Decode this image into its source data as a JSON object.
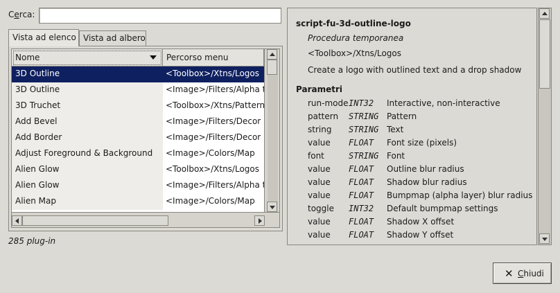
{
  "search": {
    "label_pre": "C",
    "label_underline": "e",
    "label_post": "rca:",
    "value": ""
  },
  "tabs": [
    {
      "label": "Vista ad elenco",
      "active": true
    },
    {
      "label": "Vista ad albero",
      "active": false
    }
  ],
  "list": {
    "columns": [
      "Nome",
      "Percorso menu"
    ],
    "rows": [
      {
        "name": "3D Outline",
        "path": "<Toolbox>/Xtns/Logos",
        "selected": true
      },
      {
        "name": "3D Outline",
        "path": "<Image>/Filters/Alpha to Logo"
      },
      {
        "name": "3D Truchet",
        "path": "<Toolbox>/Xtns/Patterns"
      },
      {
        "name": "Add Bevel",
        "path": "<Image>/Filters/Decor"
      },
      {
        "name": "Add Border",
        "path": "<Image>/Filters/Decor"
      },
      {
        "name": "Adjust Foreground & Background",
        "path": "<Image>/Colors/Map"
      },
      {
        "name": "Alien Glow",
        "path": "<Toolbox>/Xtns/Logos"
      },
      {
        "name": "Alien Glow",
        "path": "<Image>/Filters/Alpha to Logo"
      },
      {
        "name": "Alien Map",
        "path": "<Image>/Colors/Map"
      }
    ]
  },
  "plugin_count": "285 plug-in",
  "detail": {
    "name": "script-fu-3d-outline-logo",
    "type": "Procedura temporanea",
    "menu_path": "<Toolbox>/Xtns/Logos",
    "description": "Create a logo with outlined text and a drop shadow",
    "params_title": "Parametri",
    "params": [
      {
        "name": "run-mode",
        "type": "INT32",
        "desc": "Interactive, non-interactive"
      },
      {
        "name": "pattern",
        "type": "STRING",
        "desc": "Pattern"
      },
      {
        "name": "string",
        "type": "STRING",
        "desc": "Text"
      },
      {
        "name": "value",
        "type": "FLOAT",
        "desc": "Font size (pixels)"
      },
      {
        "name": "font",
        "type": "STRING",
        "desc": "Font"
      },
      {
        "name": "value",
        "type": "FLOAT",
        "desc": "Outline blur radius"
      },
      {
        "name": "value",
        "type": "FLOAT",
        "desc": "Shadow blur radius"
      },
      {
        "name": "value",
        "type": "FLOAT",
        "desc": "Bumpmap (alpha layer) blur radius"
      },
      {
        "name": "toggle",
        "type": "INT32",
        "desc": "Default bumpmap settings"
      },
      {
        "name": "value",
        "type": "FLOAT",
        "desc": "Shadow X offset"
      },
      {
        "name": "value",
        "type": "FLOAT",
        "desc": "Shadow Y offset"
      }
    ]
  },
  "buttons": {
    "close_icon": "✕",
    "close_pre": "",
    "close_underline": "C",
    "close_post": "hiudi"
  },
  "icons": {
    "close": "close-icon",
    "sort": "sort-down-icon"
  },
  "colors": {
    "selection": "#0f2060",
    "window_bg": "#dcdad5"
  }
}
